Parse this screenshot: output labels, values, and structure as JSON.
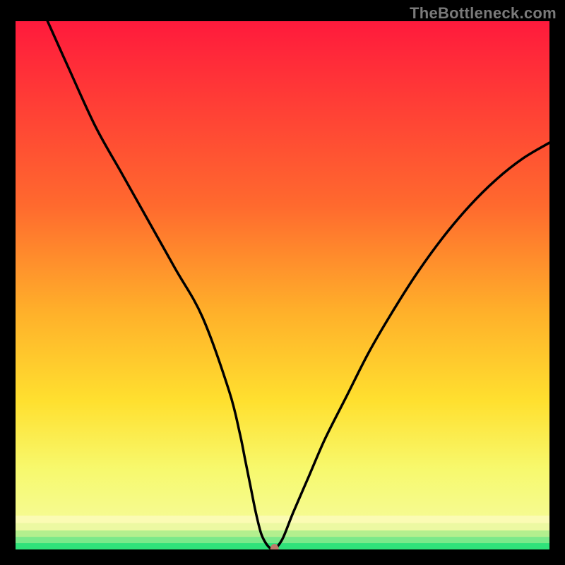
{
  "watermark": "TheBottleneck.com",
  "chart_data": {
    "type": "line",
    "title": "",
    "xlabel": "",
    "ylabel": "",
    "xlim": [
      0,
      100
    ],
    "ylim": [
      0,
      100
    ],
    "grid": false,
    "series": [
      {
        "name": "curve",
        "x": [
          6,
          10,
          15,
          20,
          25,
          30,
          35,
          40,
          42,
          43,
          44,
          45,
          46,
          47,
          48,
          48.5,
          50,
          52,
          55,
          58,
          62,
          66,
          70,
          75,
          80,
          85,
          90,
          95,
          100
        ],
        "values": [
          100,
          91,
          80,
          71,
          62,
          53,
          44,
          30,
          22,
          17,
          12,
          7,
          3,
          1,
          0,
          0,
          2,
          7,
          14,
          21,
          29,
          37,
          44,
          52,
          59,
          65,
          70,
          74,
          77
        ]
      }
    ],
    "marker": {
      "x": 48.5,
      "y": 0,
      "color": "#bf7a6a"
    },
    "bottom_bands": [
      {
        "y0": 0,
        "y1": 1.2,
        "color": "#2fe27a"
      },
      {
        "y0": 1.2,
        "y1": 2.4,
        "color": "#7ae98a"
      },
      {
        "y0": 2.4,
        "y1": 3.6,
        "color": "#b3ef8e"
      },
      {
        "y0": 3.6,
        "y1": 5.0,
        "color": "#ecf9a2"
      },
      {
        "y0": 5.0,
        "y1": 6.4,
        "color": "#fbfbb4"
      }
    ],
    "gradient_stops": [
      {
        "offset": 0,
        "color": "#ff1a3c"
      },
      {
        "offset": 35,
        "color": "#ff6a2e"
      },
      {
        "offset": 55,
        "color": "#ffb02a"
      },
      {
        "offset": 72,
        "color": "#ffe02f"
      },
      {
        "offset": 85,
        "color": "#f7f96e"
      },
      {
        "offset": 100,
        "color": "#f5fca8"
      }
    ]
  }
}
